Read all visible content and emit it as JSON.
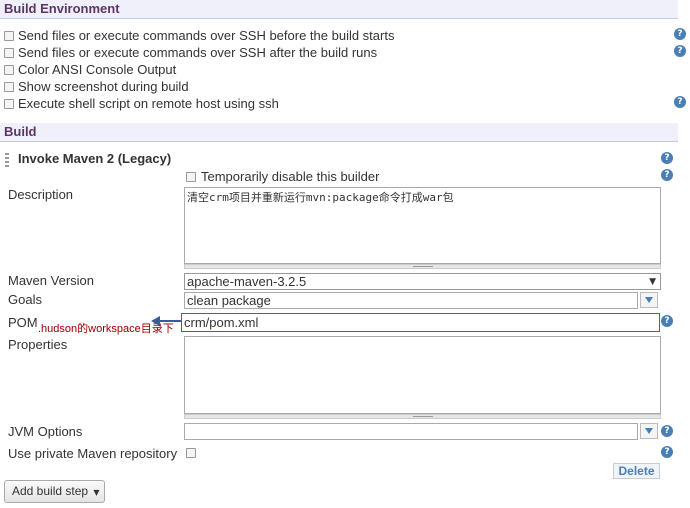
{
  "build_environment": {
    "title": "Build Environment",
    "options": [
      {
        "label": "Send files or execute commands over SSH before the build starts",
        "checked": false,
        "help": true
      },
      {
        "label": "Send files or execute commands over SSH after the build runs",
        "checked": false,
        "help": true
      },
      {
        "label": "Color ANSI Console Output",
        "checked": false,
        "help": false
      },
      {
        "label": "Show screenshot during build",
        "checked": false,
        "help": false
      },
      {
        "label": "Execute shell script on remote host using ssh",
        "checked": false,
        "help": true
      }
    ]
  },
  "build": {
    "title": "Build",
    "step": {
      "title": "Invoke Maven 2 (Legacy)",
      "disable_label": "Temporarily disable this builder",
      "description_label": "Description",
      "description_value": "清空crm项目并重新运行mvn:package命令打成war包",
      "maven_version_label": "Maven Version",
      "maven_version_value": "apache-maven-3.2.5",
      "goals_label": "Goals",
      "goals_value": "clean package",
      "pom_label": "POM",
      "pom_value": "crm/pom.xml",
      "pom_annotation": ".hudson的workspace目录下",
      "properties_label": "Properties",
      "properties_value": "",
      "jvm_options_label": "JVM Options",
      "jvm_options_value": "",
      "private_repo_label": "Use private Maven repository",
      "delete_label": "Delete"
    },
    "add_build_step_label": "Add build step"
  },
  "colors": {
    "section_title": "#5c3566",
    "help_icon": "#4a7fb5",
    "annotation": "#a00000",
    "highlight_border": "#c0392b"
  },
  "icons": {
    "help": "help-icon",
    "drag": "drag-handle-icon",
    "dropdown": "chevron-down-icon"
  }
}
